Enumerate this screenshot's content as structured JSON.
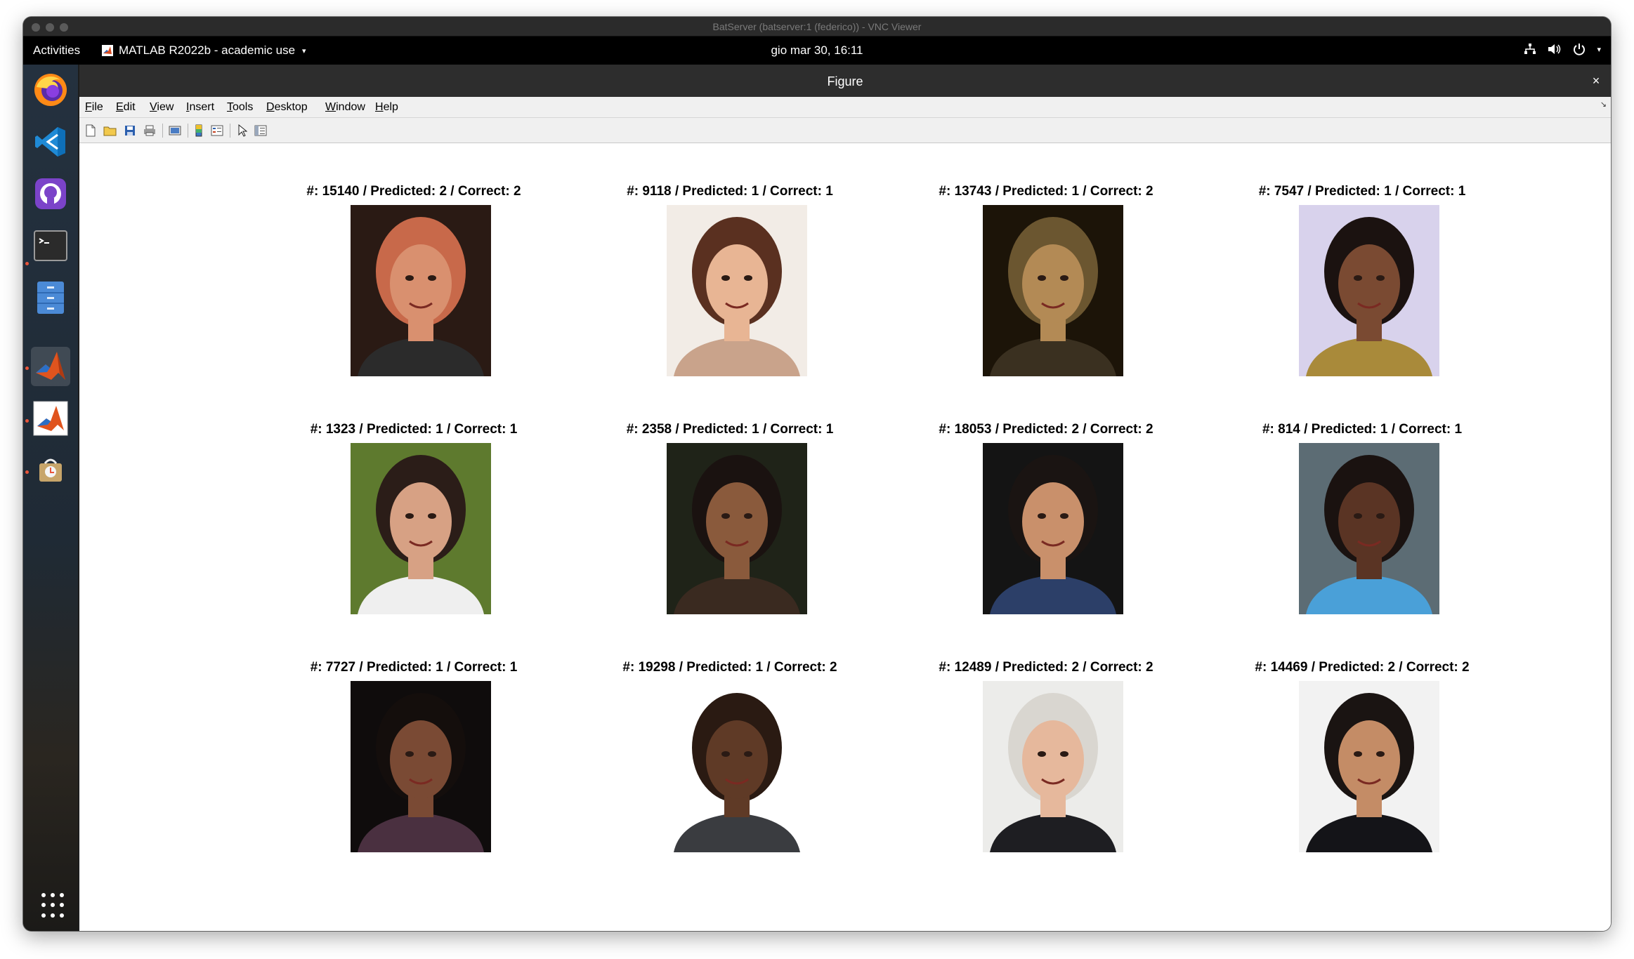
{
  "vnc": {
    "title": "BatServer (batserver:1 (federico)) - VNC Viewer"
  },
  "gnome": {
    "activities": "Activities",
    "app_name": "MATLAB R2022b - academic use",
    "app_caret": "▾",
    "clock": "gio mar 30, 16:11",
    "tray_caret": "▾"
  },
  "dock": {
    "items": [
      "firefox-icon",
      "vscode-icon",
      "github-desktop-icon",
      "terminal-icon",
      "files-icon",
      "matlab-icon",
      "matlab-alt-icon",
      "software-updater-icon",
      "show-apps-icon"
    ]
  },
  "figure": {
    "title": "Figure",
    "close_glyph": "×",
    "menu": [
      "File",
      "Edit",
      "View",
      "Insert",
      "Tools",
      "Desktop",
      "Window",
      "Help"
    ],
    "menu_mnemonic": [
      "F",
      "E",
      "V",
      "I",
      "T",
      "D",
      "W",
      "H"
    ],
    "menu_corner": "↘",
    "toolbar": [
      "new-figure-icon",
      "open-file-icon",
      "save-icon",
      "print-icon",
      "print-preview-icon",
      "colorbar-icon",
      "legend-icon",
      "edit-plot-icon",
      "property-inspector-icon"
    ]
  },
  "subplots": [
    {
      "title": "#: 15140 / Predicted: 2 / Correct: 2",
      "bg": "#2a1a14",
      "skin": "#d9906f",
      "hair": "#c8694a",
      "shirt": "#2b2b2b"
    },
    {
      "title": "#: 9118 / Predicted: 1 / Correct: 1",
      "bg": "#f2ece6",
      "skin": "#e8b594",
      "hair": "#5a3020",
      "shirt": "#c9a38b"
    },
    {
      "title": "#: 13743 / Predicted: 1 / Correct: 2",
      "bg": "#1c1408",
      "skin": "#b38a55",
      "hair": "#6b5630",
      "shirt": "#3a3020"
    },
    {
      "title": "#: 7547 / Predicted: 1 / Correct: 1",
      "bg": "#d8d2ec",
      "skin": "#7a4a32",
      "hair": "#1b1210",
      "shirt": "#a98a3a"
    },
    {
      "title": "#: 1323 / Predicted: 1 / Correct: 1",
      "bg": "#5e7a2e",
      "skin": "#d7a184",
      "hair": "#2b1d18",
      "shirt": "#efefef"
    },
    {
      "title": "#: 2358 / Predicted: 1 / Correct: 1",
      "bg": "#1f2318",
      "skin": "#8a5a3c",
      "hair": "#1a1210",
      "shirt": "#3a2a20"
    },
    {
      "title": "#: 18053 / Predicted: 2 / Correct: 2",
      "bg": "#141414",
      "skin": "#c9906b",
      "hair": "#1a1412",
      "shirt": "#2c3f68"
    },
    {
      "title": "#: 814 / Predicted: 1 / Correct: 1",
      "bg": "#5c6c74",
      "skin": "#5a3424",
      "hair": "#1a1210",
      "shirt": "#4aa0d8"
    },
    {
      "title": "#: 7727 / Predicted: 1 / Correct: 1",
      "bg": "#0f0c0c",
      "skin": "#7a4a34",
      "hair": "#140e0c",
      "shirt": "#4a3040"
    },
    {
      "title": "#: 19298 / Predicted: 1 / Correct: 2",
      "bg": "#ffffff",
      "skin": "#5f3a26",
      "hair": "#2a1a12",
      "shirt": "#3a3c40"
    },
    {
      "title": "#: 12489 / Predicted: 2 / Correct: 2",
      "bg": "#ececea",
      "skin": "#e6b89c",
      "hair": "#d9d6d0",
      "shirt": "#1e1e22"
    },
    {
      "title": "#: 14469 / Predicted: 2 / Correct: 2",
      "bg": "#f2f2f2",
      "skin": "#c48c66",
      "hair": "#1a1412",
      "shirt": "#141418"
    }
  ]
}
